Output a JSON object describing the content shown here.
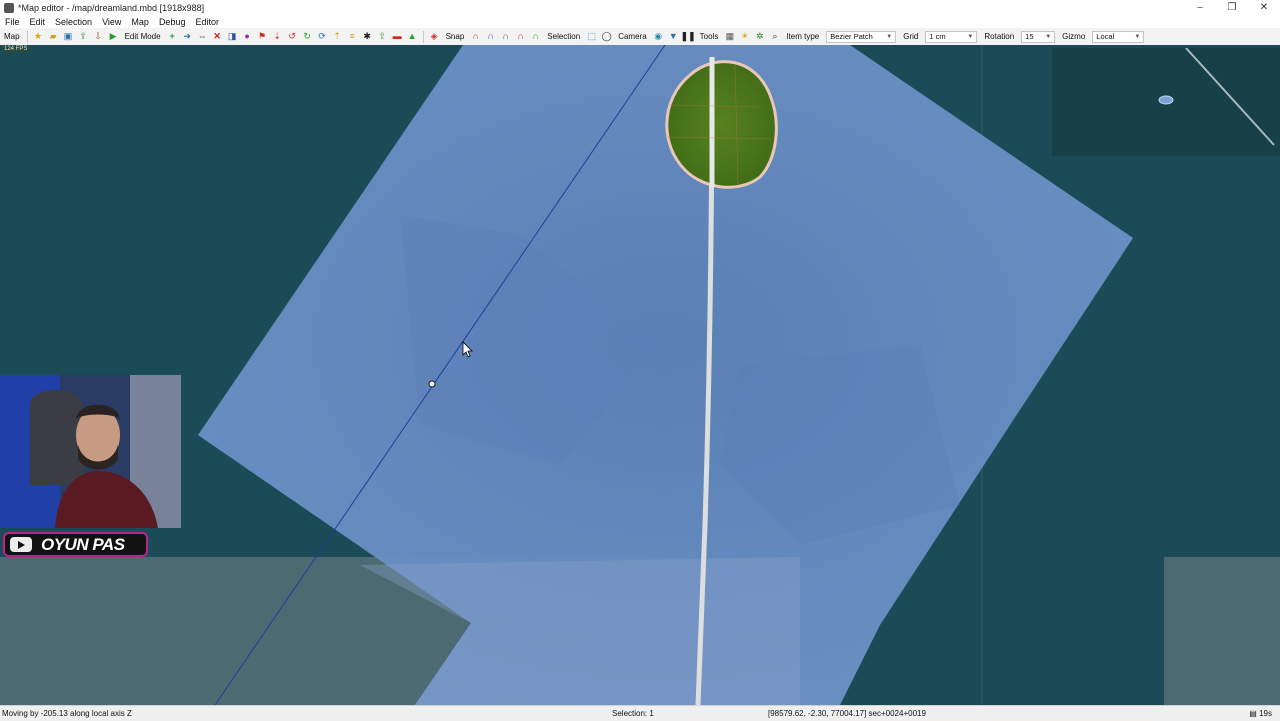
{
  "window": {
    "title": "*Map editor - /map/dreamland.mbd [1918x988]",
    "controls": [
      "–",
      "❐",
      "✕"
    ]
  },
  "menu": [
    "File",
    "Edit",
    "Selection",
    "View",
    "Map",
    "Debug",
    "Editor"
  ],
  "toolbar": {
    "map_label": "Map",
    "edit_mode_label": "Edit Mode",
    "snap_label": "Snap",
    "selection_label": "Selection",
    "camera_label": "Camera",
    "tools_label": "Tools",
    "item_type_label": "Item type",
    "item_type_value": "Bezier Patch",
    "grid_label": "Grid",
    "grid_value": "1 cm",
    "rotation_label": "Rotation",
    "rotation_value": "15",
    "gizmo_label": "Gizmo",
    "gizmo_value": "Local"
  },
  "viewport": {
    "fps_text": "124 FPS"
  },
  "overlay": {
    "channel_name": "OYUN PAS"
  },
  "status": {
    "message": "Moving by -205.13 along local axis Z",
    "selection": "Selection: 1",
    "coordinates": "[98579.62, -2.30, 77004.17] sec+0024+0019",
    "timer": "19s"
  },
  "colors": {
    "terrain": "#1c4b58",
    "patch": "#6f93c8",
    "island_grass": "#4f7a1c",
    "road": "#e6e6e6",
    "channel_border": "#c0208f"
  }
}
